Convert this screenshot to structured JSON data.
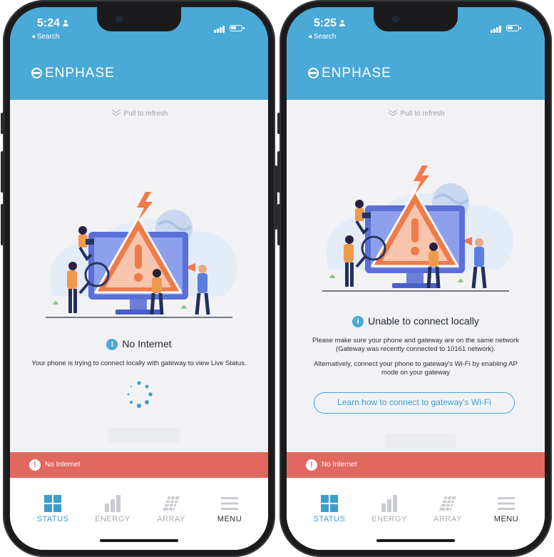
{
  "left_phone": {
    "status_bar": {
      "time": "5:24",
      "back_label": "◂ Search"
    },
    "brand": "ENPHASE",
    "pull_to_refresh": "Pull to refresh",
    "status": {
      "title": "No Internet",
      "message": "Your phone is trying to connect locally with gateway to view Live Status."
    },
    "banner": "No Internet",
    "tabs": [
      "STATUS",
      "ENERGY",
      "ARRAY",
      "MENU"
    ]
  },
  "right_phone": {
    "status_bar": {
      "time": "5:25",
      "back_label": "◂ Search"
    },
    "brand": "ENPHASE",
    "pull_to_refresh": "Pull to refresh",
    "status": {
      "title": "Unable to connect locally",
      "message_1": "Please make sure your phone and gateway are on the same network (Gateway was recently connected to 10161 network).",
      "message_2": "Alternatively, connect your phone to gateway's Wi-Fi by enabling AP mode on your gateway",
      "link_button": "Learn how to connect to gateway's Wi-Fi"
    },
    "banner": "No Internet",
    "tabs": [
      "STATUS",
      "ENERGY",
      "ARRAY",
      "MENU"
    ]
  },
  "colors": {
    "brand_blue": "#4aa9d6",
    "alert_red": "#e0685f",
    "warning_orange": "#ef7a4a"
  }
}
